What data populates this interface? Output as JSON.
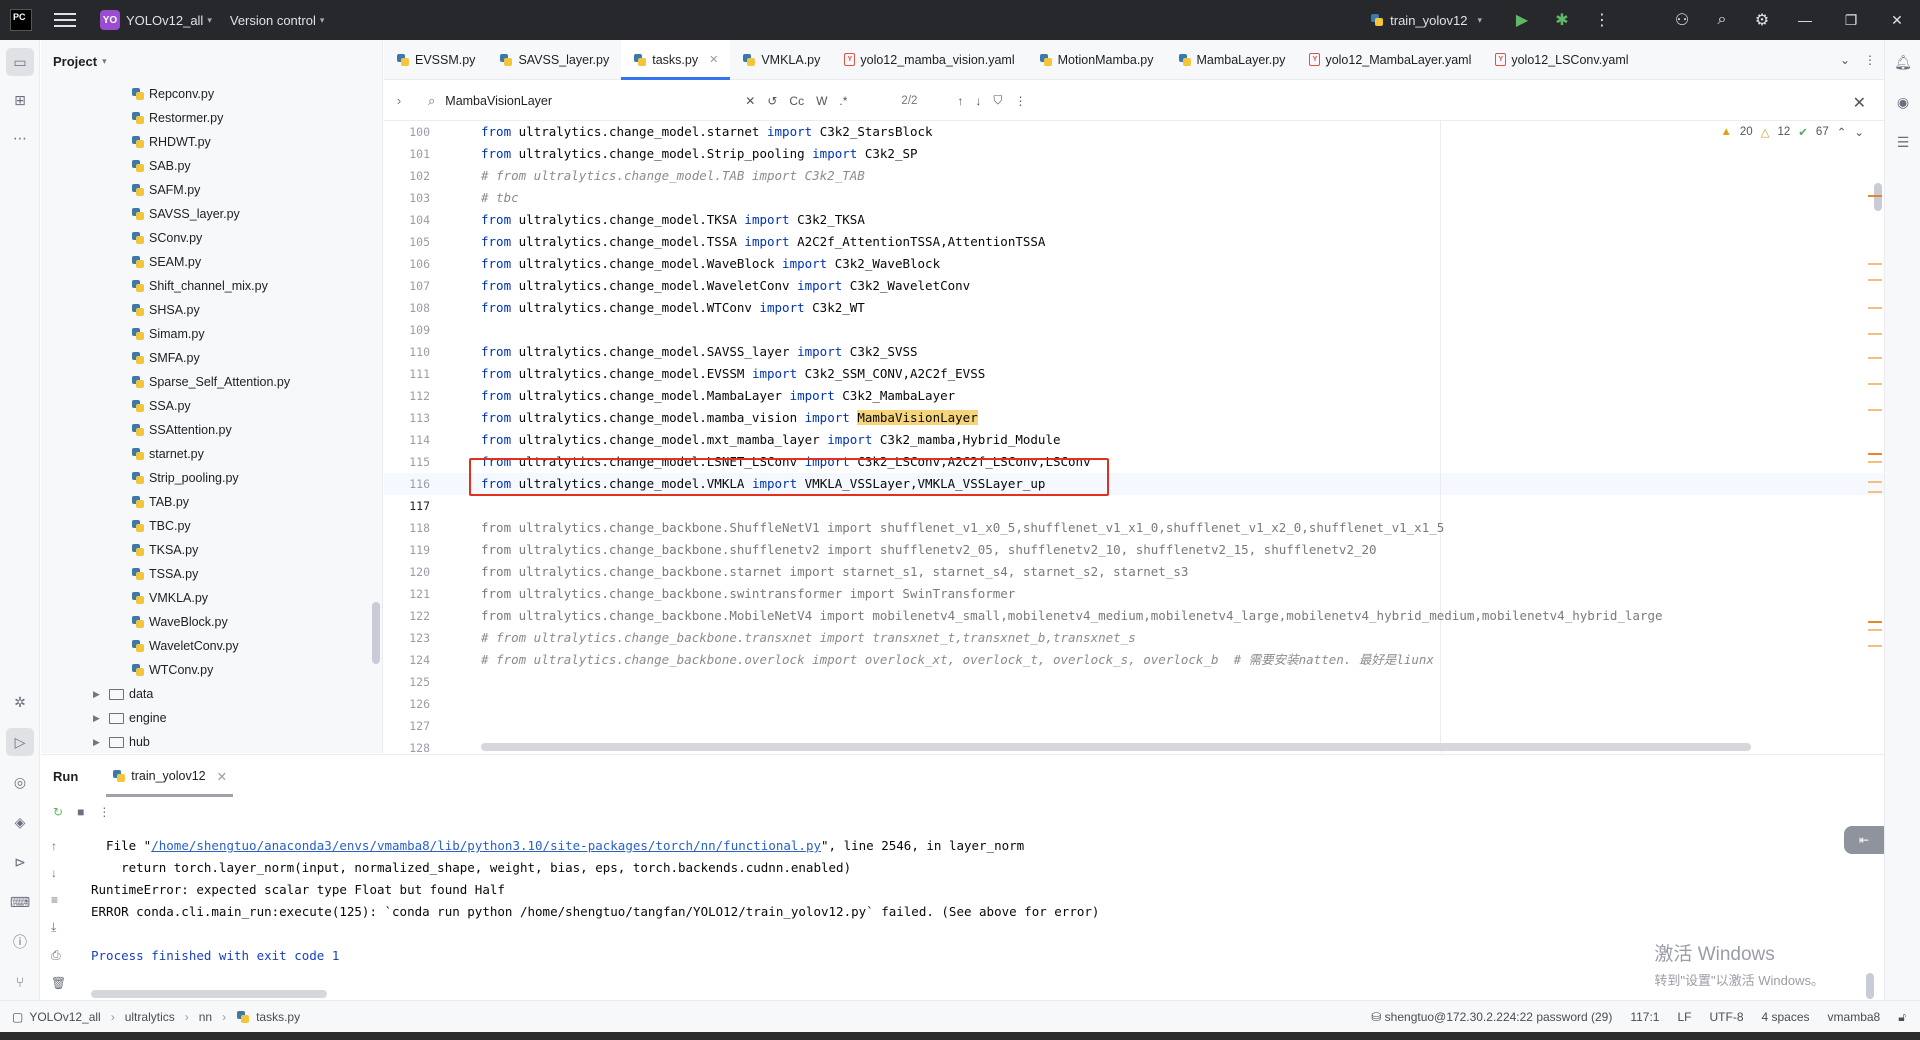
{
  "titlebar": {
    "app_logo": "PC",
    "project_badge": "YO",
    "project_name": "YOLOv12_all",
    "version_control": "Version control",
    "run_config": "train_yolov12"
  },
  "project_panel": {
    "title": "Project",
    "files": [
      "Repconv.py",
      "Restormer.py",
      "RHDWT.py",
      "SAB.py",
      "SAFM.py",
      "SAVSS_layer.py",
      "SConv.py",
      "SEAM.py",
      "Shift_channel_mix.py",
      "SHSA.py",
      "Simam.py",
      "SMFA.py",
      "Sparse_Self_Attention.py",
      "SSA.py",
      "SSAttention.py",
      "starnet.py",
      "Strip_pooling.py",
      "TAB.py",
      "TBC.py",
      "TKSA.py",
      "TSSA.py",
      "VMKLA.py",
      "WaveBlock.py",
      "WaveletConv.py",
      "WTConv.py"
    ],
    "folders": [
      "data",
      "engine",
      "hub"
    ]
  },
  "tabs": [
    {
      "label": "EVSSM.py",
      "type": "py"
    },
    {
      "label": "SAVSS_layer.py",
      "type": "py"
    },
    {
      "label": "tasks.py",
      "type": "py",
      "active": true
    },
    {
      "label": "VMKLA.py",
      "type": "py"
    },
    {
      "label": "yolo12_mamba_vision.yaml",
      "type": "yaml"
    },
    {
      "label": "MotionMamba.py",
      "type": "py"
    },
    {
      "label": "MambaLayer.py",
      "type": "py"
    },
    {
      "label": "yolo12_MambaLayer.yaml",
      "type": "yaml"
    },
    {
      "label": "yolo12_LSConv.yaml",
      "type": "yaml"
    }
  ],
  "find": {
    "query": "MambaVisionLayer",
    "match_case": "Cc",
    "words": "W",
    "regex": ".*",
    "count": "2/2"
  },
  "inspections": {
    "warnings": "20",
    "weak_warnings": "12",
    "ok": "67"
  },
  "code": {
    "line_numbers": [
      "100",
      "101",
      "102",
      "103",
      "104",
      "105",
      "106",
      "107",
      "108",
      "109",
      "110",
      "111",
      "112",
      "113",
      "114",
      "115",
      "116",
      "117",
      "118",
      "119",
      "120",
      "121",
      "122",
      "123",
      "124",
      "125",
      "126",
      "127",
      "128"
    ],
    "lines": [
      {
        "kind": "imp",
        "mod": "ultralytics.change_model.starnet",
        "names": "C3k2_StarsBlock"
      },
      {
        "kind": "imp",
        "mod": "ultralytics.change_model.Strip_pooling",
        "names": "C3k2_SP"
      },
      {
        "kind": "cm",
        "text": "# from ultralytics.change_model.TAB import C3k2_TAB"
      },
      {
        "kind": "cm",
        "text": "# tbc"
      },
      {
        "kind": "imp",
        "mod": "ultralytics.change_model.TKSA",
        "names": "C3k2_TKSA"
      },
      {
        "kind": "imp",
        "mod": "ultralytics.change_model.TSSA",
        "names": "A2C2f_AttentionTSSA,AttentionTSSA"
      },
      {
        "kind": "imp",
        "mod": "ultralytics.change_model.WaveBlock",
        "names": "C3k2_WaveBlock"
      },
      {
        "kind": "imp",
        "mod": "ultralytics.change_model.WaveletConv",
        "names": "C3k2_WaveletConv"
      },
      {
        "kind": "imp",
        "mod": "ultralytics.change_model.WTConv",
        "names": "C3k2_WT"
      },
      {
        "kind": "blank",
        "text": ""
      },
      {
        "kind": "imp",
        "mod": "ultralytics.change_model.SAVSS_layer",
        "names": "C3k2_SVSS"
      },
      {
        "kind": "imp",
        "mod": "ultralytics.change_model.EVSSM",
        "names": "C3k2_SSM_CONV,A2C2f_EVSS"
      },
      {
        "kind": "imp",
        "mod": "ultralytics.change_model.MambaLayer",
        "names": "C3k2_MambaLayer"
      },
      {
        "kind": "imphl",
        "mod": "ultralytics.change_model.mamba_vision",
        "names": "MambaVisionLayer"
      },
      {
        "kind": "imp",
        "mod": "ultralytics.change_model.mxt_mamba_layer",
        "names": "C3k2_mamba,Hybrid_Module"
      },
      {
        "kind": "imp",
        "mod": "ultralytics.change_model.LSNET_LSConv",
        "names": "C3k2_LSConv,A2C2f_LSConv,LSConv"
      },
      {
        "kind": "imp",
        "mod": "ultralytics.change_model.VMKLA",
        "names": "VMKLA_VSSLayer,VMKLA_VSSLayer_up"
      },
      {
        "kind": "blank",
        "text": ""
      },
      {
        "kind": "gray",
        "text": "from ultralytics.change_backbone.ShuffleNetV1 import shufflenet_v1_x0_5,shufflenet_v1_x1_0,shufflenet_v1_x2_0,shufflenet_v1_x1_5"
      },
      {
        "kind": "gray",
        "text": "from ultralytics.change_backbone.shufflenetv2 import shufflenetv2_05, shufflenetv2_10, shufflenetv2_15, shufflenetv2_20"
      },
      {
        "kind": "gray",
        "text": "from ultralytics.change_backbone.starnet import starnet_s1, starnet_s4, starnet_s2, starnet_s3"
      },
      {
        "kind": "gray",
        "text": "from ultralytics.change_backbone.swintransformer import SwinTransformer"
      },
      {
        "kind": "gray",
        "text": "from ultralytics.change_backbone.MobileNetV4 import mobilenetv4_small,mobilenetv4_medium,mobilenetv4_large,mobilenetv4_hybrid_medium,mobilenetv4_hybrid_large"
      },
      {
        "kind": "cm",
        "text": "# from ultralytics.change_backbone.transxnet import transxnet_t,transxnet_b,transxnet_s"
      },
      {
        "kind": "cm",
        "text": "# from ultralytics.change_backbone.overlock import overlock_xt, overlock_t, overlock_s, overlock_b  # 需要安装natten. 最好是liunx"
      },
      {
        "kind": "blank",
        "text": ""
      },
      {
        "kind": "blank",
        "text": ""
      },
      {
        "kind": "blank",
        "text": ""
      },
      {
        "kind": "blank",
        "text": ""
      }
    ],
    "keyword_from": "from",
    "keyword_import": "import"
  },
  "run": {
    "title": "Run",
    "tab": "train_yolov12",
    "console": {
      "l1_prefix": "  File \"",
      "l1_link": "/home/shengtuo/anaconda3/envs/vmamba8/lib/python3.10/site-packages/torch/nn/functional.py",
      "l1_suffix": "\", line 2546, in layer_norm",
      "l2": "    return torch.layer_norm(input, normalized_shape, weight, bias, eps, torch.backends.cudnn.enabled)",
      "l3": "RuntimeError: expected scalar type Float but found Half",
      "l4": "ERROR conda.cli.main_run:execute(125): `conda run python /home/shengtuo/tangfan/YOLO12/train_yolov12.py` failed. (See above for error)",
      "l5": "",
      "l6": "Process finished with exit code 1"
    },
    "watermark_line1": "激活 Windows",
    "watermark_line2": "转到\"设置\"以激活 Windows。"
  },
  "statusbar": {
    "crumbs": [
      "YOLOv12_all",
      "ultralytics",
      "nn",
      "tasks.py"
    ],
    "remote": "shengtuo@172.30.2.224:22 password (29)",
    "position": "117:1",
    "line_sep": "LF",
    "encoding": "UTF-8",
    "indent": "4 spaces",
    "interpreter": "vmamba8"
  }
}
